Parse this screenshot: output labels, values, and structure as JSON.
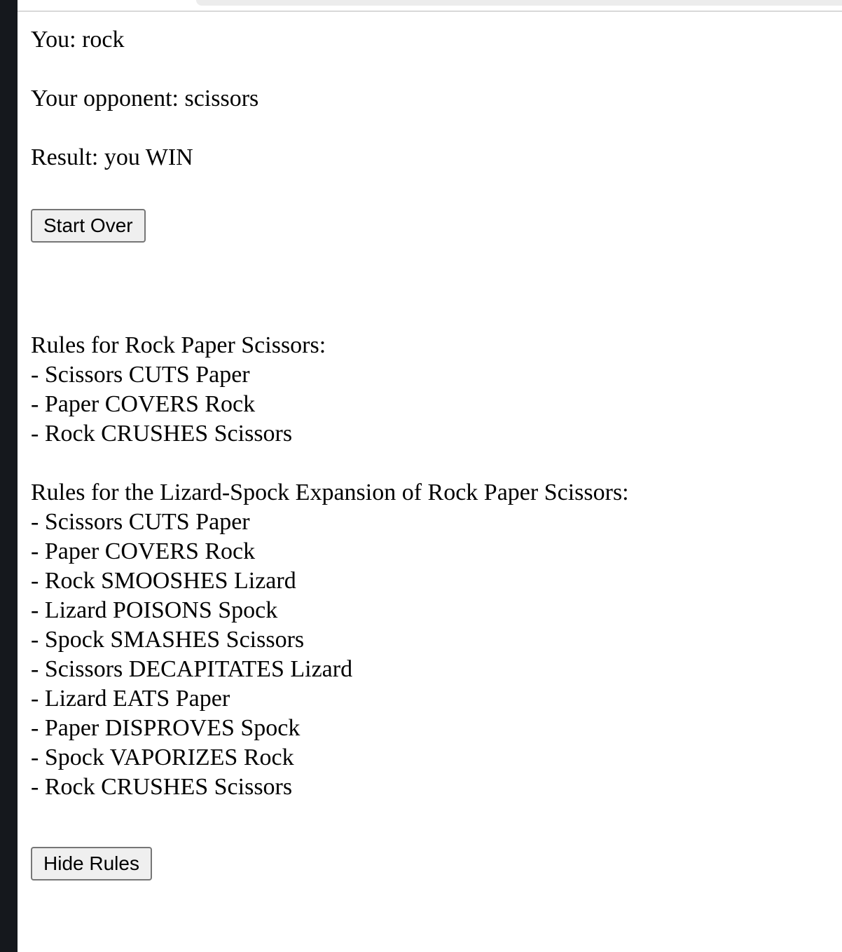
{
  "game": {
    "you_label": "You: rock",
    "opponent_label": "Your opponent: scissors",
    "result_label": "Result: you WIN",
    "start_over_button": "Start Over"
  },
  "rules": {
    "classic_title": "Rules for Rock Paper Scissors:",
    "classic_items": [
      "- Scissors CUTS Paper",
      "- Paper COVERS Rock",
      "- Rock CRUSHES Scissors"
    ],
    "expansion_title": "Rules for the Lizard-Spock Expansion of Rock Paper Scissors:",
    "expansion_items": [
      "- Scissors CUTS Paper",
      "- Paper COVERS Rock",
      "- Rock SMOOSHES Lizard",
      "- Lizard POISONS Spock",
      "- Spock SMASHES Scissors",
      "- Scissors DECAPITATES Lizard",
      "- Lizard EATS Paper",
      "- Paper DISPROVES Spock",
      "- Spock VAPORIZES Rock",
      "- Rock CRUSHES Scissors"
    ],
    "hide_rules_button": "Hide Rules"
  }
}
